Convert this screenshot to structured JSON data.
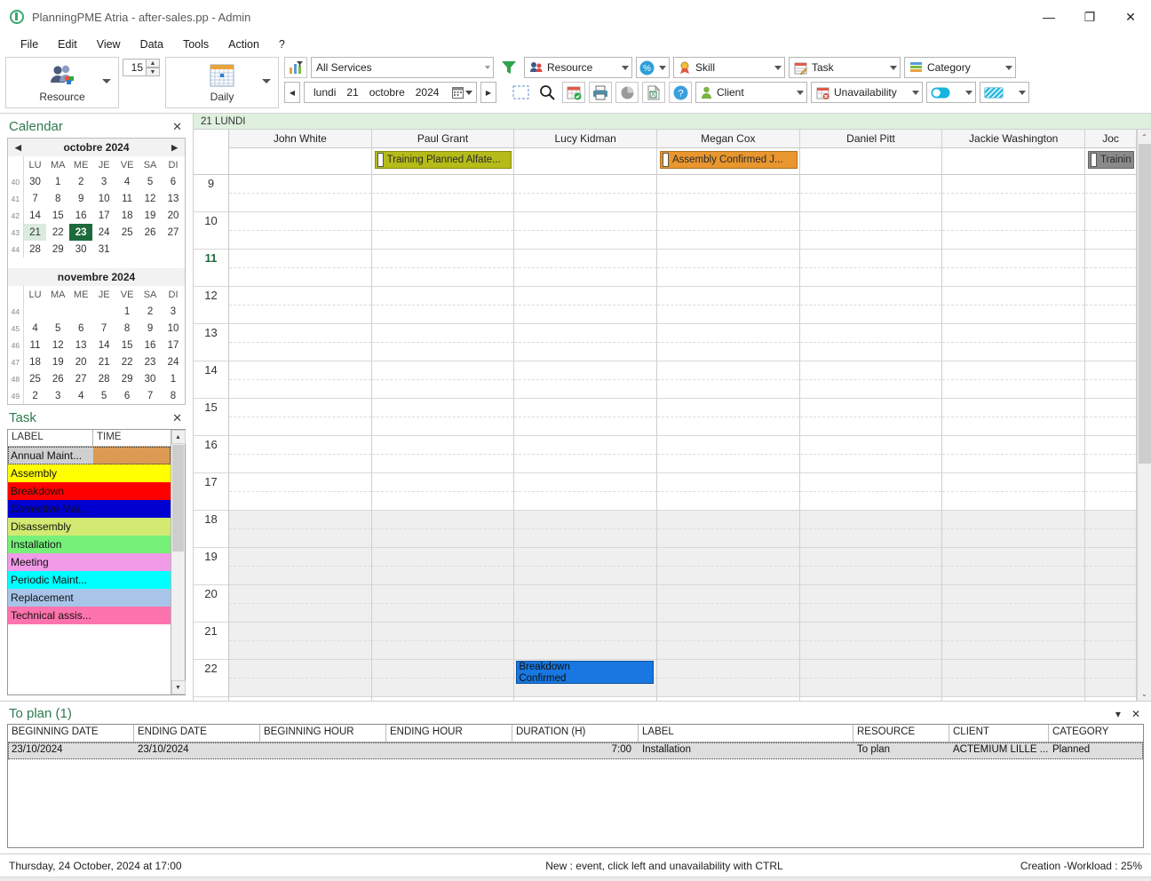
{
  "window": {
    "title": "PlanningPME Atria - after-sales.pp - Admin",
    "minimize": "—",
    "maximize": "❐",
    "close": "✕"
  },
  "menu": [
    "File",
    "Edit",
    "View",
    "Data",
    "Tools",
    "Action",
    "?"
  ],
  "ribbon": {
    "resource_button": {
      "label": "Resource",
      "icon": "resource-group-icon"
    },
    "zoom_value": "15",
    "view_button": {
      "label": "Daily",
      "icon": "calendar-day-icon"
    },
    "services_filter": "All Services",
    "filter_icon": "funnel-icon",
    "group_by": "Resource",
    "percent_button": "percent-icon",
    "skill_filter": "Skill",
    "task_filter": "Task",
    "category_filter": "Category",
    "client_filter": "Client",
    "unavailability_filter": "Unavailability",
    "date": {
      "weekday": "lundi",
      "day": "21",
      "month": "octobre",
      "year": "2024"
    },
    "prev_label": "◀",
    "next_label": "▶",
    "icons": [
      "select-rectangle-icon",
      "search-icon",
      "calendar-check-icon",
      "print-icon",
      "pie-chart-icon",
      "excel-export-icon",
      "help-icon"
    ]
  },
  "calendar_panel": {
    "title": "Calendar",
    "close": "✕",
    "months": [
      {
        "name": "octobre 2024",
        "prev": "◀",
        "next": "▶",
        "daynames": [
          "LU",
          "MA",
          "ME",
          "JE",
          "VE",
          "SA",
          "DI"
        ],
        "weeks": [
          {
            "no": "40",
            "days": [
              "30",
              "1",
              "2",
              "3",
              "4",
              "5",
              "6"
            ]
          },
          {
            "no": "41",
            "days": [
              "7",
              "8",
              "9",
              "10",
              "11",
              "12",
              "13"
            ]
          },
          {
            "no": "42",
            "days": [
              "14",
              "15",
              "16",
              "17",
              "18",
              "19",
              "20"
            ]
          },
          {
            "no": "43",
            "days": [
              "21",
              "22",
              "23",
              "24",
              "25",
              "26",
              "27"
            ]
          },
          {
            "no": "44",
            "days": [
              "28",
              "29",
              "30",
              "31",
              "",
              "",
              ""
            ]
          }
        ],
        "selected": "21",
        "today": "23"
      },
      {
        "name": "novembre 2024",
        "prev": "",
        "next": "",
        "daynames": [
          "LU",
          "MA",
          "ME",
          "JE",
          "VE",
          "SA",
          "DI"
        ],
        "weeks": [
          {
            "no": "44",
            "days": [
              "",
              "",
              "",
              "",
              "1",
              "2",
              "3"
            ]
          },
          {
            "no": "45",
            "days": [
              "4",
              "5",
              "6",
              "7",
              "8",
              "9",
              "10"
            ]
          },
          {
            "no": "46",
            "days": [
              "11",
              "12",
              "13",
              "14",
              "15",
              "16",
              "17"
            ]
          },
          {
            "no": "47",
            "days": [
              "18",
              "19",
              "20",
              "21",
              "22",
              "23",
              "24"
            ]
          },
          {
            "no": "48",
            "days": [
              "25",
              "26",
              "27",
              "28",
              "29",
              "30",
              "1"
            ]
          },
          {
            "no": "49",
            "days": [
              "2",
              "3",
              "4",
              "5",
              "6",
              "7",
              "8"
            ]
          }
        ],
        "selected": "",
        "today": ""
      }
    ]
  },
  "task_panel": {
    "title": "Task",
    "close": "✕",
    "columns": [
      "LABEL",
      "TIME"
    ],
    "rows": [
      {
        "label": "Annual Maint...",
        "color": "#dd9a52",
        "selected": true
      },
      {
        "label": "Assembly",
        "color": "#ffff00",
        "selected": false
      },
      {
        "label": "Breakdown",
        "color": "#ff0000",
        "selected": false
      },
      {
        "label": "Corrective Mai...",
        "color": "#0000d0",
        "selected": false
      },
      {
        "label": "Disassembly",
        "color": "#d3ea72",
        "selected": false
      },
      {
        "label": "Installation",
        "color": "#77f07a",
        "selected": false
      },
      {
        "label": "Meeting",
        "color": "#f09ae8",
        "selected": false
      },
      {
        "label": "Periodic Maint...",
        "color": "#00ffff",
        "selected": false
      },
      {
        "label": "Replacement",
        "color": "#a8c4e8",
        "selected": false
      },
      {
        "label": "Technical assis...",
        "color": "#fd73ad",
        "selected": false
      }
    ]
  },
  "planning": {
    "day_band": "21 LUNDI",
    "resources": [
      "John White",
      "Paul Grant",
      "Lucy Kidman",
      "Megan Cox",
      "Daniel Pitt",
      "Jackie Washington",
      "Joc"
    ],
    "hours": [
      "9",
      "10",
      "11",
      "12",
      "13",
      "14",
      "15",
      "16",
      "17",
      "18",
      "19",
      "20",
      "21",
      "22"
    ],
    "current_hour": "11",
    "off_hours_from": "18",
    "allday_events": [
      {
        "resource": "Paul Grant",
        "label": "Training Planned Alfate...",
        "color": "#b5bb18"
      },
      {
        "resource": "Megan Cox",
        "label": "Assembly Confirmed J...",
        "color": "#e8962e"
      },
      {
        "resource": "Joc",
        "label": "Trainin",
        "color": "#8a8a8a"
      }
    ],
    "timed_events": [
      {
        "resource": "Lucy Kidman",
        "label": "Breakdown",
        "sublabel": "Confirmed",
        "color": "#1877e0",
        "hour": "22"
      }
    ]
  },
  "to_plan": {
    "title": "To plan (1)",
    "collapse": "▾",
    "close": "✕",
    "columns": [
      "BEGINNING DATE",
      "ENDING DATE",
      "BEGINNING HOUR",
      "ENDING HOUR",
      "DURATION (H)",
      "LABEL",
      "RESOURCE",
      "CLIENT",
      "CATEGORY"
    ],
    "rows": [
      {
        "beginning_date": "23/10/2024",
        "ending_date": "23/10/2024",
        "beginning_hour": "",
        "ending_hour": "",
        "duration": "7:00",
        "label": "Installation",
        "resource": "To plan",
        "client": "ACTEMIUM LILLE ...",
        "category": "Planned"
      }
    ]
  },
  "status_bar": {
    "left": "Thursday, 24 October, 2024 at 17:00",
    "middle": "New : event, click left and unavailability with CTRL",
    "right": "Creation -Workload : 25%"
  },
  "colors": {
    "accent_green": "#2f7a4f",
    "band_green": "#dff0df",
    "today_green": "#1d6b3c"
  }
}
